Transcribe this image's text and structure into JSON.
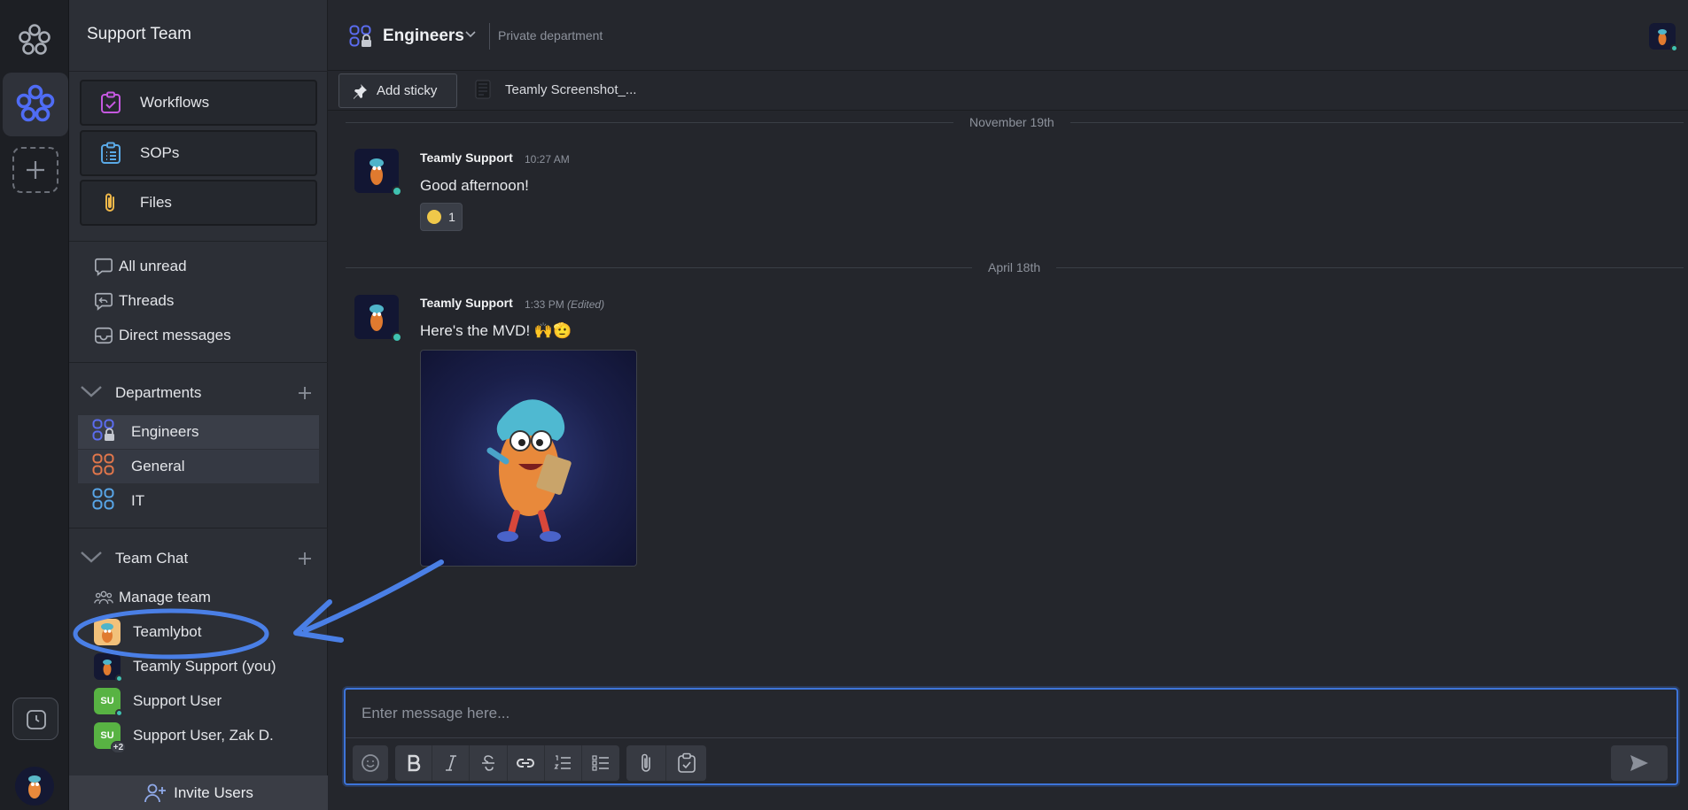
{
  "app": {
    "workspace_name": "Support Team",
    "accent": "#3d74d9",
    "online": "#3fc1b0"
  },
  "sidebar": {
    "buttons": [
      {
        "label": "Workflows",
        "icon": "workflows-icon",
        "color": "#c558e0"
      },
      {
        "label": "SOPs",
        "icon": "sops-icon",
        "color": "#5aa9e6"
      },
      {
        "label": "Files",
        "icon": "paperclip-icon",
        "color": "#f0b84a"
      }
    ],
    "nav": [
      {
        "label": "All unread",
        "icon": "chat-bubble-icon"
      },
      {
        "label": "Threads",
        "icon": "threads-icon"
      },
      {
        "label": "Direct messages",
        "icon": "inbox-icon"
      }
    ],
    "departments": {
      "title": "Departments",
      "items": [
        {
          "label": "Engineers",
          "color": "#5b6cf0"
        },
        {
          "label": "General",
          "color": "#e2774b"
        },
        {
          "label": "IT",
          "color": "#58a6e8"
        }
      ]
    },
    "team_chat": {
      "title": "Team Chat",
      "manage": "Manage team",
      "items": [
        {
          "label": "Teamlybot"
        },
        {
          "label": "Teamly Support (you)"
        },
        {
          "label": "Support User",
          "initials": "SU"
        },
        {
          "label": "Support User, Zak D.",
          "initials": "SU",
          "extra": "+2"
        }
      ]
    },
    "invite_label": "Invite Users"
  },
  "header": {
    "title": "Engineers",
    "subtitle": "Private department"
  },
  "sticky_bar": {
    "add_sticky": "Add sticky",
    "file_tab": "Teamly Screenshot_..."
  },
  "messages": [
    {
      "date": "November 19th",
      "author": "Teamly Support",
      "time": "10:27 AM",
      "edited": "",
      "text": "Good afternoon!",
      "reaction_count": "1"
    },
    {
      "date": "April 18th",
      "author": "Teamly Support",
      "time": "1:33 PM",
      "edited": "(Edited)",
      "text": "Here's the MVD! 🙌🫡"
    }
  ],
  "composer": {
    "placeholder": "Enter message here...",
    "tools": [
      "emoji-icon",
      "bold-icon",
      "italic-icon",
      "strikethrough-icon",
      "link-icon",
      "ordered-list-icon",
      "bullet-list-icon",
      "attach-icon",
      "checklist-icon"
    ]
  }
}
